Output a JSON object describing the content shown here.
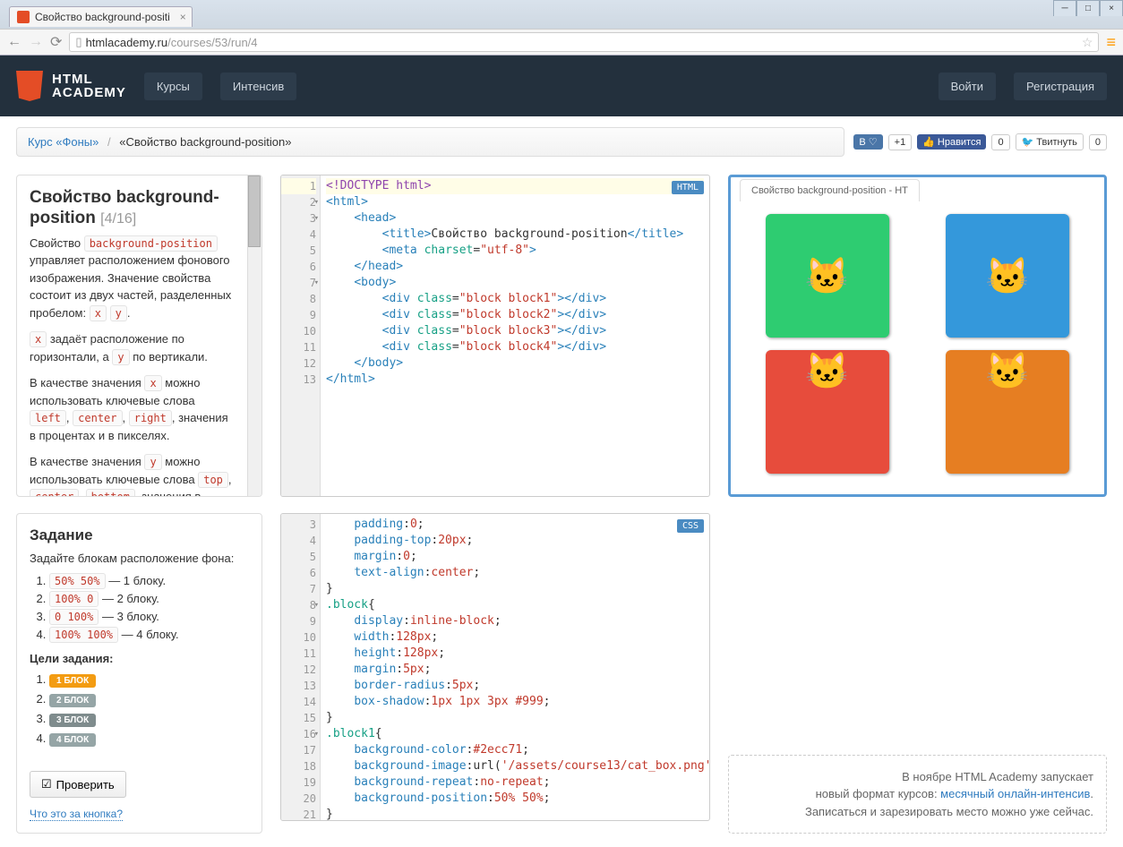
{
  "browser": {
    "tab_title": "Свойство background-positi",
    "url_host": "htmlacademy.ru",
    "url_path": "/courses/53/run/4"
  },
  "header": {
    "logo1": "HTML",
    "logo2": "ACADEMY",
    "nav1": "Курсы",
    "nav2": "Интенсив",
    "login": "Войти",
    "register": "Регистрация"
  },
  "breadcrumb": {
    "link": "Курс «Фоны»",
    "sep": "/",
    "current": "«Свойство background-position»"
  },
  "social": {
    "vk_count": "+1",
    "fb": "Нравится",
    "fb_count": "0",
    "tw": "Твитнуть",
    "tw_count": "0"
  },
  "theory": {
    "title": "Свойство background-position",
    "progress": "[4/16]",
    "p1_a": "Свойство ",
    "p1_code": "background-position",
    "p1_b": " управляет расположением фонового изображения. Значение свойства состоит из двух частей, разделенных пробелом: ",
    "p1_x": "x",
    "p1_sp": " ",
    "p1_y": "y",
    "p1_dot": ".",
    "p2_a": "",
    "p2_x": "x",
    "p2_b": " задаёт расположение по горизонтали, а ",
    "p2_y": "y",
    "p2_c": " по вертикали.",
    "p3_a": "В качестве значения ",
    "p3_x": "x",
    "p3_b": " можно использовать ключевые слова ",
    "p3_l": "left",
    "p3_s1": ", ",
    "p3_c": "center",
    "p3_s2": ", ",
    "p3_r": "right",
    "p3_d": ", значения в процентах и в пикселях.",
    "p4_a": "В качестве значения ",
    "p4_y": "y",
    "p4_b": " можно использовать ключевые слова ",
    "p4_t": "top",
    "p4_s1": ", ",
    "p4_c": "center",
    "p4_s2": ", ",
    "p4_bt": "bottom",
    "p4_d": ", значения в"
  },
  "task": {
    "title": "Задание",
    "intro": "Задайте блокам расположение фона:",
    "items": [
      {
        "code": "50% 50%",
        "txt": " — 1 блоку."
      },
      {
        "code": "100% 0",
        "txt": " — 2 блоку."
      },
      {
        "code": "0 100%",
        "txt": " — 3 блоку."
      },
      {
        "code": "100% 100%",
        "txt": " — 4 блоку."
      }
    ],
    "goals_label": "Цели задания:",
    "goals": [
      "1 БЛОК",
      "2 БЛОК",
      "3 БЛОК",
      "4 БЛОК"
    ],
    "check": "Проверить",
    "what": "Что это за кнопка?"
  },
  "html_editor": {
    "badge": "HTML",
    "lines": [
      "1",
      "2",
      "3",
      "4",
      "5",
      "6",
      "7",
      "8",
      "9",
      "10",
      "11",
      "12",
      "13"
    ]
  },
  "css_editor": {
    "badge": "CSS",
    "lines": [
      "3",
      "4",
      "5",
      "6",
      "7",
      "8",
      "9",
      "10",
      "11",
      "12",
      "13",
      "14",
      "15",
      "16",
      "17",
      "18",
      "19",
      "20",
      "21"
    ]
  },
  "preview": {
    "tab": "Свойство background-position - HT"
  },
  "promo": {
    "l1": "В ноябре HTML Academy запускает",
    "l2a": "новый формат курсов: ",
    "l2b": "месячный онлайн-интенсив",
    "l2c": ".",
    "l3": "Записаться и зарезировать место можно уже сейчас."
  }
}
